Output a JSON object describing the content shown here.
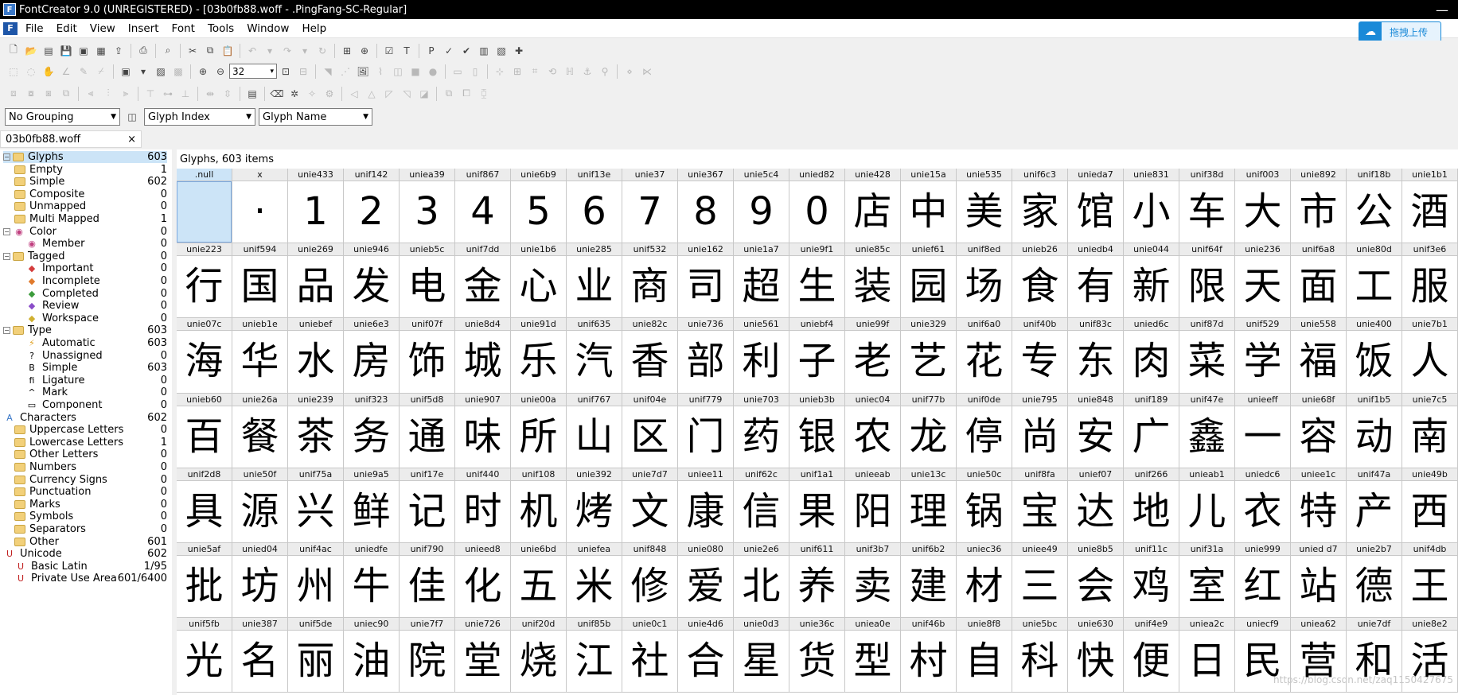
{
  "titlebar": {
    "title": "FontCreator 9.0 (UNREGISTERED) - [03b0fb88.woff - .PingFang-SC-Regular]",
    "close": "—"
  },
  "menu": [
    "File",
    "Edit",
    "View",
    "Insert",
    "Font",
    "Tools",
    "Window",
    "Help"
  ],
  "upload_button": "拖拽上传",
  "toolbar": {
    "zoom": "32"
  },
  "combos": {
    "grouping": "No Grouping",
    "index": "Glyph Index",
    "name": "Glyph Name"
  },
  "doc_tab": {
    "name": "03b0fb88.woff",
    "close": "×"
  },
  "tree": [
    {
      "label": "Glyphs",
      "count": "603",
      "level": 0,
      "exp": "−",
      "icon": "folder",
      "sel": true
    },
    {
      "label": "Empty",
      "count": "1",
      "level": 1,
      "icon": "folder"
    },
    {
      "label": "Simple",
      "count": "602",
      "level": 1,
      "icon": "folder"
    },
    {
      "label": "Composite",
      "count": "0",
      "level": 1,
      "icon": "folder"
    },
    {
      "label": "Unmapped",
      "count": "0",
      "level": 1,
      "icon": "folder"
    },
    {
      "label": "Multi Mapped",
      "count": "1",
      "level": 1,
      "icon": "folder"
    },
    {
      "label": "Color",
      "count": "0",
      "level": 0,
      "exp": "−",
      "icon": "color"
    },
    {
      "label": "Member",
      "count": "0",
      "level": 2,
      "icon": "color"
    },
    {
      "label": "Tagged",
      "count": "0",
      "level": 0,
      "exp": "−",
      "icon": "folder"
    },
    {
      "label": "Important",
      "count": "0",
      "level": 2,
      "icon": "tag-red"
    },
    {
      "label": "Incomplete",
      "count": "0",
      "level": 2,
      "icon": "tag-orange"
    },
    {
      "label": "Completed",
      "count": "0",
      "level": 2,
      "icon": "tag-green"
    },
    {
      "label": "Review",
      "count": "0",
      "level": 2,
      "icon": "tag-purple"
    },
    {
      "label": "Workspace",
      "count": "0",
      "level": 2,
      "icon": "tag-yellow"
    },
    {
      "label": "Type",
      "count": "603",
      "level": 0,
      "exp": "−",
      "icon": "folder"
    },
    {
      "label": "Automatic",
      "count": "603",
      "level": 2,
      "icon": "bolt"
    },
    {
      "label": "Unassigned",
      "count": "0",
      "level": 2,
      "icon": "question"
    },
    {
      "label": "Simple",
      "count": "603",
      "level": 2,
      "icon": "b"
    },
    {
      "label": "Ligature",
      "count": "0",
      "level": 2,
      "icon": "fi"
    },
    {
      "label": "Mark",
      "count": "0",
      "level": 2,
      "icon": "caret"
    },
    {
      "label": "Component",
      "count": "0",
      "level": 2,
      "icon": "box"
    },
    {
      "label": "Characters",
      "count": "602",
      "level": 0,
      "icon": "char"
    },
    {
      "label": "Uppercase Letters",
      "count": "0",
      "level": 1,
      "icon": "folder"
    },
    {
      "label": "Lowercase Letters",
      "count": "1",
      "level": 1,
      "icon": "folder"
    },
    {
      "label": "Other Letters",
      "count": "0",
      "level": 1,
      "icon": "folder"
    },
    {
      "label": "Numbers",
      "count": "0",
      "level": 1,
      "icon": "folder"
    },
    {
      "label": "Currency Signs",
      "count": "0",
      "level": 1,
      "icon": "folder"
    },
    {
      "label": "Punctuation",
      "count": "0",
      "level": 1,
      "icon": "folder"
    },
    {
      "label": "Marks",
      "count": "0",
      "level": 1,
      "icon": "folder"
    },
    {
      "label": "Symbols",
      "count": "0",
      "level": 1,
      "icon": "folder"
    },
    {
      "label": "Separators",
      "count": "0",
      "level": 1,
      "icon": "folder"
    },
    {
      "label": "Other",
      "count": "601",
      "level": 1,
      "icon": "folder"
    },
    {
      "label": "Unicode",
      "count": "602",
      "level": 0,
      "icon": "uni"
    },
    {
      "label": "Basic Latin",
      "count": "1/95",
      "level": 1,
      "icon": "uni"
    },
    {
      "label": "Private Use Area",
      "count": "601/6400",
      "level": 1,
      "icon": "uni"
    }
  ],
  "grid": {
    "header": "Glyphs, 603 items",
    "rows": [
      {
        "names": [
          ".null",
          "x",
          "unie433",
          "unif142",
          "uniea39",
          "unif867",
          "unie6b9",
          "unif13e",
          "unie37",
          "unie367",
          "unie5c4",
          "unied82",
          "unie428",
          "unie15a",
          "unie535",
          "unif6c3",
          "unieda7",
          "unie831",
          "unif38d",
          "unif003",
          "unie892",
          "unif18b",
          "unie1b1"
        ],
        "chars": [
          "",
          "·",
          "1",
          "2",
          "3",
          "4",
          "5",
          "6",
          "7",
          "8",
          "9",
          "0",
          "店",
          "中",
          "美",
          "家",
          "馆",
          "小",
          "车",
          "大",
          "市",
          "公",
          "酒"
        ]
      },
      {
        "names": [
          "unie223",
          "unif594",
          "unie269",
          "unie946",
          "unieb5c",
          "unif7dd",
          "unie1b6",
          "unie285",
          "unif532",
          "unie162",
          "unie1a7",
          "unie9f1",
          "unie85c",
          "unief61",
          "unif8ed",
          "unieb26",
          "uniedb4",
          "unie044",
          "unif64f",
          "unie236",
          "unif6a8",
          "unie80d",
          "unif3e6"
        ],
        "chars": [
          "行",
          "国",
          "品",
          "发",
          "电",
          "金",
          "心",
          "业",
          "商",
          "司",
          "超",
          "生",
          "装",
          "园",
          "场",
          "食",
          "有",
          "新",
          "限",
          "天",
          "面",
          "工",
          "服"
        ]
      },
      {
        "names": [
          "unie07c",
          "unieb1e",
          "uniebef",
          "unie6e3",
          "unif07f",
          "unie8d4",
          "unie91d",
          "unif635",
          "unie82c",
          "unie736",
          "unie561",
          "uniebf4",
          "unie99f",
          "unie329",
          "unif6a0",
          "unif40b",
          "unif83c",
          "unied6c",
          "unif87d",
          "unif529",
          "unie558",
          "unie400",
          "unie7b1"
        ],
        "chars": [
          "海",
          "华",
          "水",
          "房",
          "饰",
          "城",
          "乐",
          "汽",
          "香",
          "部",
          "利",
          "子",
          "老",
          "艺",
          "花",
          "专",
          "东",
          "肉",
          "菜",
          "学",
          "福",
          "饭",
          "人"
        ]
      },
      {
        "names": [
          "unieb60",
          "unie26a",
          "unie239",
          "unif323",
          "unif5d8",
          "unie907",
          "unie00a",
          "unif767",
          "unif04e",
          "unif779",
          "unie703",
          "unieb3b",
          "uniec04",
          "unif77b",
          "unif0de",
          "unie795",
          "unie848",
          "unif189",
          "unif47e",
          "unieeff",
          "unie68f",
          "unif1b5",
          "unie7c5"
        ],
        "chars": [
          "百",
          "餐",
          "茶",
          "务",
          "通",
          "味",
          "所",
          "山",
          "区",
          "门",
          "药",
          "银",
          "农",
          "龙",
          "停",
          "尚",
          "安",
          "广",
          "鑫",
          "一",
          "容",
          "动",
          "南"
        ]
      },
      {
        "names": [
          "unif2d8",
          "unie50f",
          "unif75a",
          "unie9a5",
          "unif17e",
          "unif440",
          "unif108",
          "unie392",
          "unie7d7",
          "uniee11",
          "unif62c",
          "unif1a1",
          "unieeab",
          "unie13c",
          "unie50c",
          "unif8fa",
          "unief07",
          "unif266",
          "unieab1",
          "uniedc6",
          "uniee1c",
          "unif47a",
          "unie49b"
        ],
        "chars": [
          "具",
          "源",
          "兴",
          "鲜",
          "记",
          "时",
          "机",
          "烤",
          "文",
          "康",
          "信",
          "果",
          "阳",
          "理",
          "锅",
          "宝",
          "达",
          "地",
          "儿",
          "衣",
          "特",
          "产",
          "西"
        ]
      },
      {
        "names": [
          "unie5af",
          "unied04",
          "unif4ac",
          "uniedfe",
          "unif790",
          "unieed8",
          "unie6bd",
          "uniefea",
          "unif848",
          "unie080",
          "unie2e6",
          "unif611",
          "unif3b7",
          "unif6b2",
          "uniec36",
          "uniee49",
          "unie8b5",
          "unif11c",
          "unif31a",
          "unie999",
          "unied d7",
          "unie2b7",
          "unif4db"
        ],
        "chars": [
          "批",
          "坊",
          "州",
          "牛",
          "佳",
          "化",
          "五",
          "米",
          "修",
          "爱",
          "北",
          "养",
          "卖",
          "建",
          "材",
          "三",
          "会",
          "鸡",
          "室",
          "红",
          "站",
          "德",
          "王"
        ]
      },
      {
        "names": [
          "unif5fb",
          "unie387",
          "unif5de",
          "uniec90",
          "unie7f7",
          "unie726",
          "unif20d",
          "unif85b",
          "unie0c1",
          "unie4d6",
          "unie0d3",
          "unie36c",
          "uniea0e",
          "unif46b",
          "unie8f8",
          "unie5bc",
          "unie630",
          "unif4e9",
          "uniea2c",
          "uniecf9",
          "uniea62",
          "unie7df",
          "unie8e2"
        ],
        "chars": [
          "光",
          "名",
          "丽",
          "油",
          "院",
          "堂",
          "烧",
          "江",
          "社",
          "合",
          "星",
          "货",
          "型",
          "村",
          "自",
          "科",
          "快",
          "便",
          "日",
          "民",
          "营",
          "和",
          "活"
        ]
      }
    ]
  },
  "watermark": "https://blog.csdn.net/zaq1150427675"
}
